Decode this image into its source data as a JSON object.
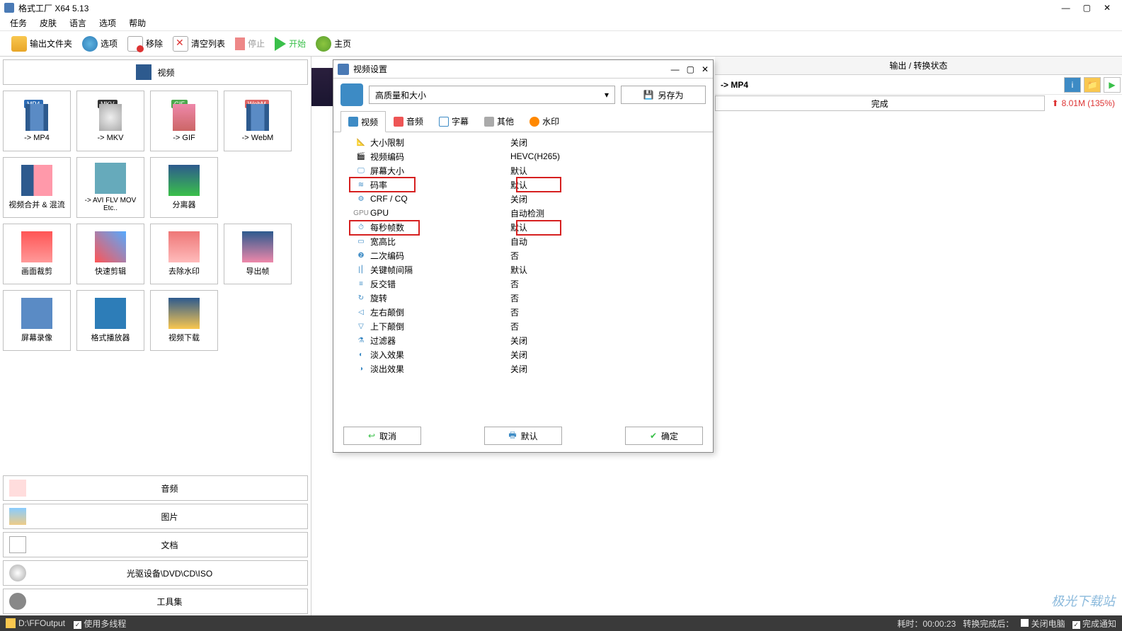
{
  "app": {
    "title": "格式工厂 X64 5.13"
  },
  "menu": {
    "task": "任务",
    "skin": "皮肤",
    "lang": "语言",
    "option": "选项",
    "help": "帮助"
  },
  "toolbar": {
    "output_folder": "输出文件夹",
    "option": "选项",
    "remove": "移除",
    "clear": "清空列表",
    "stop": "停止",
    "start": "开始",
    "home": "主页"
  },
  "categories": {
    "video": "视频",
    "audio": "音频",
    "image": "图片",
    "document": "文档",
    "disc": "光驱设备\\DVD\\CD\\ISO",
    "tools": "工具集"
  },
  "tiles": {
    "mp4": "-> MP4",
    "mkv": "-> MKV",
    "gif": "-> GIF",
    "webm": "-> WebM",
    "merge": "视频合并 & 混流",
    "avi": "-> AVI FLV MOV Etc..",
    "split": "分离器",
    "crop": "画面裁剪",
    "quickcut": "快速剪辑",
    "removewm": "去除水印",
    "export": "导出帧",
    "record": "屏幕录像",
    "player": "格式播放器",
    "download": "视频下载"
  },
  "output": {
    "header": "输出 / 转换状态",
    "task": "-> MP4",
    "done": "完成",
    "size": "8.01M  (135%)"
  },
  "dialog": {
    "title": "视频设置",
    "preset": "高质量和大小",
    "saveas": "另存为",
    "tabs": {
      "video": "视频",
      "audio": "音频",
      "subtitle": "字幕",
      "other": "其他",
      "watermark": "水印"
    },
    "settings": [
      {
        "label": "大小限制",
        "value": "关闭"
      },
      {
        "label": "视频编码",
        "value": "HEVC(H265)"
      },
      {
        "label": "屏幕大小",
        "value": "默认"
      },
      {
        "label": "码率",
        "value": "默认"
      },
      {
        "label": "CRF / CQ",
        "value": "关闭"
      },
      {
        "label": "GPU",
        "value": "自动检测"
      },
      {
        "label": "每秒帧数",
        "value": "默认"
      },
      {
        "label": "宽高比",
        "value": "自动"
      },
      {
        "label": "二次编码",
        "value": "否"
      },
      {
        "label": "关键帧间隔",
        "value": "默认"
      },
      {
        "label": "反交错",
        "value": "否"
      },
      {
        "label": "旋转",
        "value": "否"
      },
      {
        "label": "左右颠倒",
        "value": "否"
      },
      {
        "label": "上下颠倒",
        "value": "否"
      },
      {
        "label": "过滤器",
        "value": "关闭"
      },
      {
        "label": "淡入效果",
        "value": "关闭"
      },
      {
        "label": "淡出效果",
        "value": "关闭"
      }
    ],
    "cancel": "取消",
    "default": "默认",
    "ok": "确定"
  },
  "status": {
    "path": "D:\\FFOutput",
    "multithread": "使用多线程",
    "elapsed": "耗时：00:00:23",
    "afterdone": "转换完成后：",
    "shutdown": "关闭电脑",
    "notify": "完成通知"
  },
  "watermark": {
    "name": "极光下载站"
  }
}
